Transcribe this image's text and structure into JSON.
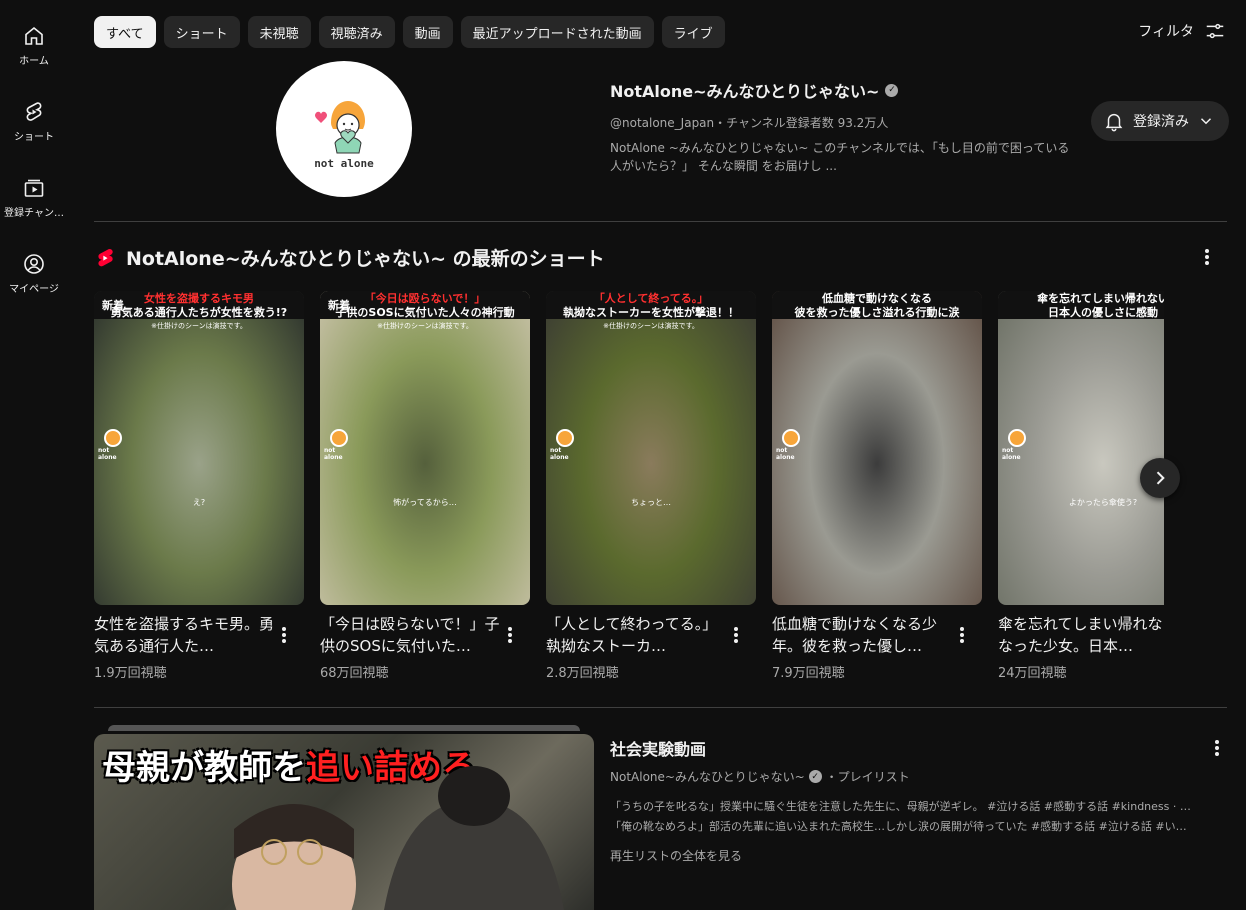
{
  "sidebar": {
    "items": [
      {
        "label": "ホーム",
        "icon": "home-icon"
      },
      {
        "label": "ショート",
        "icon": "shorts-icon"
      },
      {
        "label": "登録チャン…",
        "icon": "subscriptions-icon"
      },
      {
        "label": "マイページ",
        "icon": "account-icon"
      }
    ]
  },
  "chips": [
    "すべて",
    "ショート",
    "未視聴",
    "視聴済み",
    "動画",
    "最近アップロードされた動画",
    "ライブ"
  ],
  "active_chip": "すべて",
  "filter_label": "フィルタ",
  "channel": {
    "avatar_text": "not alone",
    "name": "NotAlone~みんなひとりじゃない~",
    "meta": "@notalone_Japan・チャンネル登録者数 93.2万人",
    "description": "NotAlone ~みんなひとりじゃない~ このチャンネルでは、「もし目の前で困っている人がいたら？」 そんな瞬間 をお届けし ...",
    "subscribe_label": "登録済み"
  },
  "shorts_section": {
    "title": "NotAlone~みんなひとりじゃない~ の最新のショート",
    "items": [
      {
        "head1": "女性を盗撮するキモ男",
        "head2": "勇気ある通行人たちが女性を救う!?",
        "badge": "新着",
        "sub": "※仕掛けのシーンは演技です。",
        "caption": "え?",
        "title": "女性を盗撮するキモ男。勇気ある通行人た…",
        "views": "1.9万回視聴",
        "colors": [
          "#6b7a4a",
          "#2a2f2c",
          "#9aa289"
        ]
      },
      {
        "head1": "「今日は殴らないで！」",
        "head2": "子供のSOSに気付いた人々の神行動",
        "badge": "新着",
        "sub": "※仕掛けのシーンは演技です。",
        "caption": "怖がってるから…",
        "title": "「今日は殴らないで！」子供のSOSに気付いた…",
        "views": "68万回視聴",
        "colors": [
          "#8a9a5a",
          "#c9c2a9",
          "#55603c"
        ]
      },
      {
        "head1": "「人として終ってる。」",
        "head2": "執拗なストーカーを女性が撃退！！",
        "badge": "",
        "sub": "※仕掛けのシーンは演技です。",
        "caption": "ちょっと…",
        "title": "「人として終わってる。」執拗なストーカ…",
        "views": "2.8万回視聴",
        "colors": [
          "#5b6a2e",
          "#3a3a33",
          "#8a7b5c"
        ]
      },
      {
        "head1": "低血糖で動けなくなる",
        "head2": "彼を救った優しさ溢れる行動に涙",
        "badge": "",
        "sub": "",
        "caption": "",
        "title": "低血糖で動けなくなる少年。彼を救った優し…",
        "views": "7.9万回視聴",
        "colors": [
          "#9a9a92",
          "#5d4b40",
          "#3c3c3c"
        ]
      },
      {
        "head1": "傘を忘れてしまい帰れない",
        "head2": "日本人の優しさに感動",
        "badge": "",
        "sub": "",
        "caption": "よかったら傘使う?",
        "title": "傘を忘れてしまい帰れなくなった少女。日本…",
        "views": "24万回視聴",
        "colors": [
          "#9b9b94",
          "#6a6e62",
          "#c9c8bf"
        ]
      }
    ]
  },
  "playlist": {
    "caption_white": "母親が教師を",
    "caption_red": "追い詰める",
    "title": "社会実験動画",
    "channel": "NotAlone~みんなひとりじゃない~",
    "type": "・プレイリスト",
    "desc1": "「うちの子を叱るな」授業中に騒ぐ生徒を注意した先生に、母親が逆ギレ。 #泣ける話 #感動する話 #kindness · …",
    "desc2": "「俺の靴なめろよ」部活の先輩に追い込まれた高校生…しかし涙の展開が待っていた #感動する話 #泣ける話 #い…",
    "view_all": "再生リストの全体を見る"
  }
}
